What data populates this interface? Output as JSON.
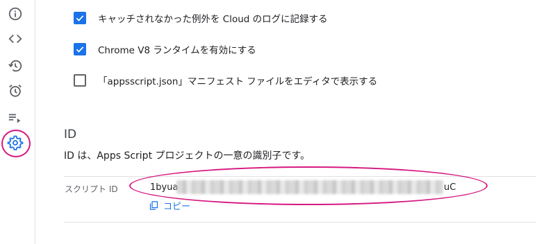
{
  "rail": {
    "items": [
      {
        "name": "overview",
        "icon": "info-icon"
      },
      {
        "name": "editor",
        "icon": "code-icon"
      },
      {
        "name": "executions-history",
        "icon": "history-icon"
      },
      {
        "name": "triggers",
        "icon": "alarm-clock-icon"
      },
      {
        "name": "executions",
        "icon": "playlist-play-icon"
      },
      {
        "name": "project-settings",
        "icon": "gear-icon",
        "active": true
      }
    ]
  },
  "settings": {
    "options": [
      {
        "label": "キャッチされなかった例外を Cloud のログに記録する",
        "checked": true
      },
      {
        "label": "Chrome V8 ランタイムを有効にする",
        "checked": true
      },
      {
        "label": "「appsscript.json」マニフェスト ファイルをエディタで表示する",
        "checked": false
      }
    ]
  },
  "id_section": {
    "heading": "ID",
    "description": "ID は、Apps Script プロジェクトの一意の識別子です。",
    "script_id_label": "スクリプト ID",
    "script_id_start": "1byua",
    "script_id_end": "uC",
    "copy_label": "コピー"
  },
  "colors": {
    "accent": "#1a73e8",
    "annotation": "#d6177f",
    "icon": "#5f6368"
  }
}
